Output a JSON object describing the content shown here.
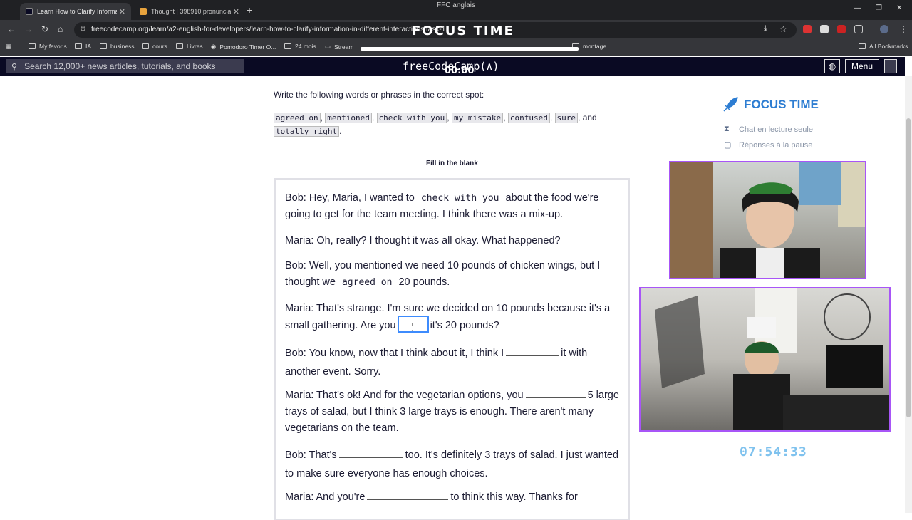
{
  "window": {
    "title": "FFC anglais"
  },
  "tabs": [
    {
      "label": "Learn How to Clarify Informatio",
      "active": true
    },
    {
      "label": "Thought | 398910 pronunciatio",
      "active": false
    }
  ],
  "address": {
    "url": "freecodecamp.org/learn/a2-english-for-developers/learn-how-to-clarify-information-in-different-interactions/task-1"
  },
  "overlay": {
    "focus_time": "FOCUS TIME",
    "timer": "00:00"
  },
  "bookmarks": [
    {
      "label": "My favoris",
      "icon": "folder-icon"
    },
    {
      "label": "IA",
      "icon": "folder-icon"
    },
    {
      "label": "business",
      "icon": "folder-icon"
    },
    {
      "label": "cours",
      "icon": "folder-icon"
    },
    {
      "label": "Livres",
      "icon": "folder-icon"
    },
    {
      "label": "Pomodoro Timer O...",
      "icon": "check-icon"
    },
    {
      "label": "24 mois",
      "icon": "folder-icon"
    },
    {
      "label": "Stream",
      "icon": "video-icon"
    },
    {
      "label": "montage",
      "icon": "folder-icon"
    }
  ],
  "all_bookmarks": "All Bookmarks",
  "fcc_nav": {
    "search_placeholder": "Search 12,000+ news articles, tutorials, and books",
    "brand": "freeCodeCamp(∧)",
    "menu": "Menu"
  },
  "lesson": {
    "instruction": "Write the following words or phrases in the correct spot:",
    "chips": [
      "agreed on",
      "mentioned",
      "check with you",
      "my mistake",
      "confused",
      "sure",
      "totally right"
    ],
    "and_word": "and",
    "fill_title": "Fill in the blank",
    "p1a": "Bob: Hey, Maria, I wanted to",
    "p1ans": "check with you",
    "p1b": "about the food we're going to get for the team meeting. I think there was a mix-up.",
    "p2": "Maria: Oh, really? I thought it was all okay. What happened?",
    "p3a": "Bob: Well, you mentioned we need 10 pounds of chicken wings, but I thought we",
    "p3ans": "agreed on",
    "p3b": "20 pounds.",
    "p4a": "Maria: That's strange. I'm sure we decided on 10 pounds because it's a small gathering. Are you",
    "p4b": "it's 20 pounds?",
    "p5a": "Bob: You know, now that I think about it, I think I",
    "p5b": "it with another event. Sorry.",
    "p6a": "Maria: That's ok! And for the vegetarian options, you",
    "p6b": "5 large trays of salad, but I think 3 large trays is enough. There aren't many vegetarians on the team.",
    "p7a": "Bob: That's",
    "p7b": "too. It's definitely 3 trays of salad. I just wanted to make sure everyone has enough choices.",
    "p8a": "Maria: And you're",
    "p8b": "to think this way. Thanks for"
  },
  "sidebar": {
    "title": "FOCUS TIME",
    "chat": "Chat en lecture seule",
    "replies": "Réponses à la pause"
  },
  "clock": "07:54:33",
  "colors": {
    "accent": "#2d7dd2",
    "cam_border": "#a855f7",
    "clock": "#7fc2ee"
  }
}
